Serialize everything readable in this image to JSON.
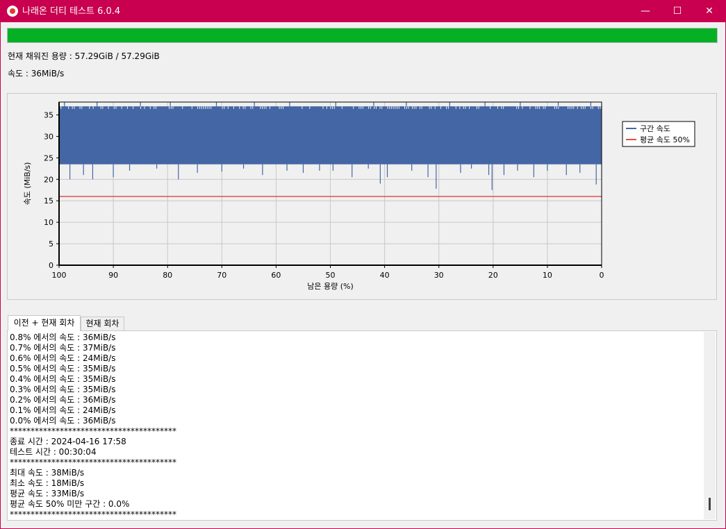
{
  "window": {
    "title": "나래온 더티 테스트 6.0.4",
    "minimize_glyph": "—",
    "maximize_glyph": "☐",
    "close_glyph": "✕",
    "titlebar_color": "#c8004f"
  },
  "progress": {
    "value": 1.0,
    "color": "#06b025"
  },
  "status": {
    "filled": "현재 채워진 용량 : 57.29GiB / 57.29GiB",
    "speed": "속도 : 36MiB/s"
  },
  "chart_data": {
    "type": "area",
    "title": "",
    "xlabel": "남은 용량 (%)",
    "ylabel": "속도 (MiB/s)",
    "xlim": [
      100,
      0
    ],
    "ylim": [
      0,
      38
    ],
    "x_ticks": [
      "100",
      "90",
      "80",
      "70",
      "60",
      "50",
      "40",
      "30",
      "20",
      "10",
      "0"
    ],
    "y_ticks": [
      "0",
      "5",
      "10",
      "15",
      "20",
      "25",
      "30",
      "35"
    ],
    "grid": true,
    "legend_position": "top-right",
    "series": [
      {
        "name": "구간 속도",
        "color": "#4466a4",
        "typical_range": [
          23.5,
          37
        ],
        "dips": [
          [
            99.9,
            25
          ],
          [
            98,
            20
          ],
          [
            95.5,
            21
          ],
          [
            93.8,
            20
          ],
          [
            90,
            20.5
          ],
          [
            87,
            22
          ],
          [
            82,
            22.5
          ],
          [
            78,
            20
          ],
          [
            74.5,
            21.5
          ],
          [
            70,
            21.8
          ],
          [
            66,
            22.5
          ],
          [
            62.5,
            21
          ],
          [
            58,
            22
          ],
          [
            55,
            21.5
          ],
          [
            52,
            22
          ],
          [
            49.5,
            22
          ],
          [
            46,
            20.5
          ],
          [
            43,
            22.5
          ],
          [
            40.8,
            19
          ],
          [
            39.5,
            20.5
          ],
          [
            35,
            22
          ],
          [
            32,
            20.5
          ],
          [
            30.5,
            17.8
          ],
          [
            26,
            21.5
          ],
          [
            24,
            22.5
          ],
          [
            20.8,
            21
          ],
          [
            20.2,
            17.5
          ],
          [
            18,
            21
          ],
          [
            15.5,
            22
          ],
          [
            12.5,
            20.5
          ],
          [
            10,
            22
          ],
          [
            6.5,
            21
          ],
          [
            4,
            21.5
          ],
          [
            1,
            18.8
          ]
        ],
        "peaks": [
          99,
          93,
          85,
          79.5,
          71,
          64,
          57.5,
          49,
          42,
          36,
          28,
          21.5,
          15,
          8,
          2
        ]
      },
      {
        "name": "평균 속도 50%",
        "color": "#e05050",
        "value": 16
      }
    ]
  },
  "tabs": [
    "이전 + 현재 회차",
    "현재 회차"
  ],
  "log": {
    "lines": [
      "0.8% 에서의 속도 : 36MiB/s",
      "0.7% 에서의 속도 : 37MiB/s",
      "0.6% 에서의 속도 : 24MiB/s",
      "0.5% 에서의 속도 : 35MiB/s",
      "0.4% 에서의 속도 : 35MiB/s",
      "0.3% 에서의 속도 : 35MiB/s",
      "0.2% 에서의 속도 : 36MiB/s",
      "0.1% 에서의 속도 : 24MiB/s",
      "0.0% 에서의 속도 : 36MiB/s",
      "****************************************",
      "종료 시간 : 2024-04-16 17:58",
      "테스트 시간 : 00:30:04",
      "****************************************",
      "최대 속도 : 38MiB/s",
      "최소 속도 : 18MiB/s",
      "평균 속도 : 33MiB/s",
      "평균 속도 50% 미만 구간 : 0.0%",
      "****************************************"
    ]
  }
}
